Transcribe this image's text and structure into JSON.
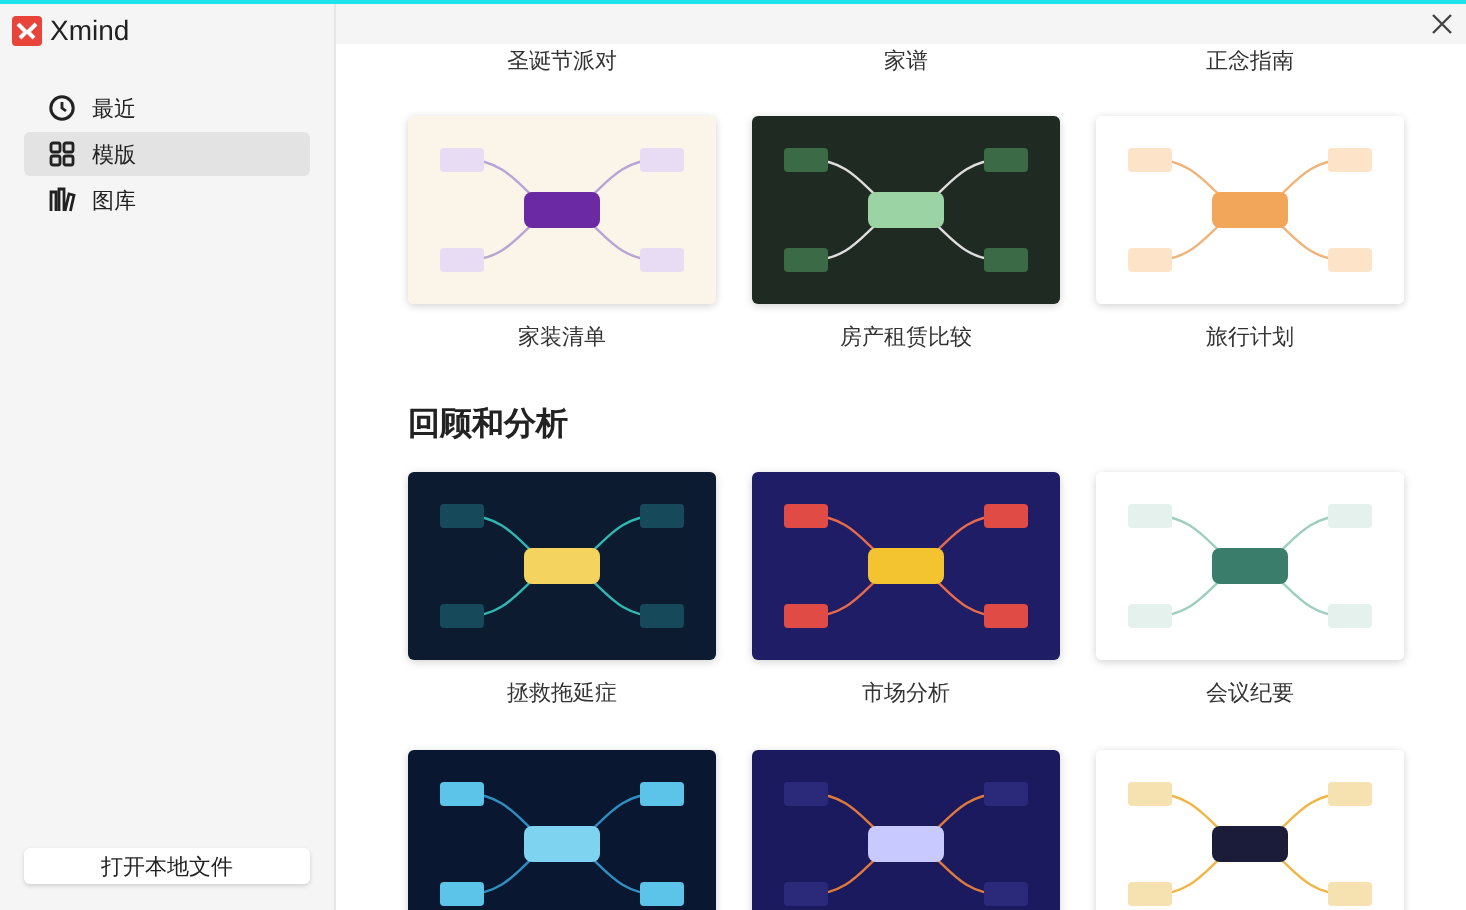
{
  "app": {
    "name": "Xmind"
  },
  "sidebar": {
    "items": [
      {
        "label": "最近",
        "selected": false
      },
      {
        "label": "模版",
        "selected": true
      },
      {
        "label": "图库",
        "selected": false
      }
    ],
    "open_button": "打开本地文件"
  },
  "sections": [
    {
      "templates": [
        {
          "kind": "label",
          "caption": "圣诞节派对"
        },
        {
          "kind": "label",
          "caption": "家谱"
        },
        {
          "kind": "label",
          "caption": "正念指南"
        },
        {
          "kind": "full",
          "caption": "家装清单"
        },
        {
          "kind": "full",
          "caption": "房产租赁比较"
        },
        {
          "kind": "full",
          "caption": "旅行计划"
        }
      ]
    },
    {
      "heading": "回顾和分析",
      "templates": [
        {
          "kind": "full",
          "caption": "拯救拖延症"
        },
        {
          "kind": "full",
          "caption": "市场分析"
        },
        {
          "kind": "full",
          "caption": "会议纪要"
        },
        {
          "kind": "thumbnail"
        },
        {
          "kind": "thumbnail"
        },
        {
          "kind": "thumbnail"
        }
      ]
    }
  ]
}
